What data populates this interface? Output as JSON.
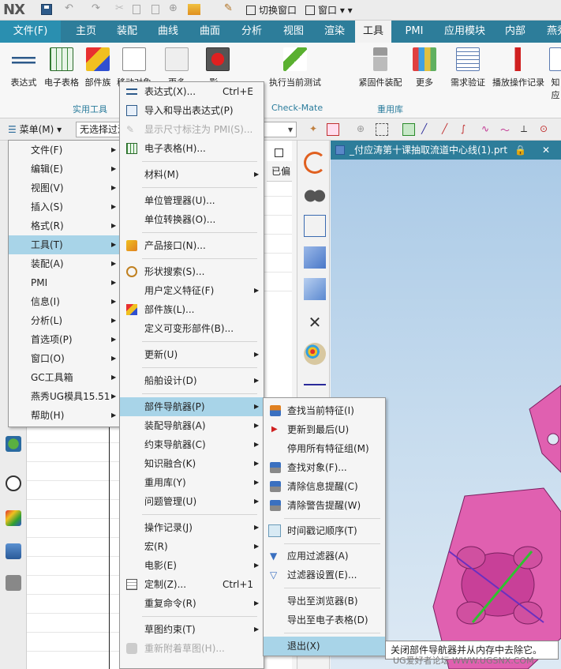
{
  "app": {
    "logo": "NX"
  },
  "titlebar": {
    "switch_window": "切换窗口",
    "window": "窗口"
  },
  "tabs": [
    "文件(F)",
    "主页",
    "装配",
    "曲线",
    "曲面",
    "分析",
    "视图",
    "渲染",
    "工具",
    "PMI",
    "应用模块",
    "内部",
    "燕秀"
  ],
  "ribbon": {
    "buttons": [
      "表达式",
      "电子表格",
      "部件族",
      "移动对象",
      "更多",
      "影...",
      "执行当前测试",
      "紧固件装配",
      "更多",
      "需求验证",
      "播放操作记录",
      "知应"
    ],
    "groups": [
      "实用工具",
      "Check-Mate",
      "重用库"
    ]
  },
  "cmdbar": {
    "menu": "菜单(M)",
    "filter": "无选择过滤器"
  },
  "nav": {
    "column_header": "已偏"
  },
  "graphics": {
    "tab_title": "_付应涛第十课抽取流道中心线(1).prt"
  },
  "menu_main": [
    {
      "label": "文件(F)",
      "sub": true
    },
    {
      "label": "编辑(E)",
      "sub": true
    },
    {
      "label": "视图(V)",
      "sub": true
    },
    {
      "label": "插入(S)",
      "sub": true
    },
    {
      "label": "格式(R)",
      "sub": true
    },
    {
      "label": "工具(T)",
      "sub": true
    },
    {
      "label": "装配(A)",
      "sub": true
    },
    {
      "label": "PMI",
      "sub": true
    },
    {
      "label": "信息(I)",
      "sub": true
    },
    {
      "label": "分析(L)",
      "sub": true
    },
    {
      "label": "首选项(P)",
      "sub": true
    },
    {
      "label": "窗口(O)",
      "sub": true
    },
    {
      "label": "GC工具箱",
      "sub": true
    },
    {
      "label": "燕秀UG模具15.51",
      "sub": true
    },
    {
      "label": "帮助(H)",
      "sub": true
    }
  ],
  "menu_tools": [
    {
      "label": "表达式(X)...",
      "shortcut": "Ctrl+E"
    },
    {
      "label": "导入和导出表达式(P)"
    },
    {
      "label": "显示尺寸标注为 PMI(S)..."
    },
    {
      "label": "电子表格(H)..."
    },
    {
      "label": "材料(M)"
    },
    {
      "label": "单位管理器(U)..."
    },
    {
      "label": "单位转换器(O)..."
    },
    {
      "label": "产品接口(N)..."
    },
    {
      "label": "形状搜索(S)..."
    },
    {
      "label": "用户定义特征(F)"
    },
    {
      "label": "部件族(L)..."
    },
    {
      "label": "定义可变形部件(B)..."
    },
    {
      "label": "更新(U)"
    },
    {
      "label": "船舶设计(D)"
    },
    {
      "label": "部件导航器(P)"
    },
    {
      "label": "装配导航器(A)"
    },
    {
      "label": "约束导航器(C)"
    },
    {
      "label": "知识融合(K)"
    },
    {
      "label": "重用库(Y)"
    },
    {
      "label": "问题管理(U)"
    },
    {
      "label": "操作记录(J)"
    },
    {
      "label": "宏(R)"
    },
    {
      "label": "电影(E)"
    },
    {
      "label": "定制(Z)...",
      "shortcut": "Ctrl+1"
    },
    {
      "label": "重复命令(R)"
    },
    {
      "label": "草图约束(T)"
    },
    {
      "label": "重新附着草图(H)..."
    }
  ],
  "menu_part_nav": [
    {
      "label": "查找当前特征(I)"
    },
    {
      "label": "更新到最后(U)"
    },
    {
      "label": "停用所有特征组(M)"
    },
    {
      "label": "查找对象(F)..."
    },
    {
      "label": "清除信息提醒(C)"
    },
    {
      "label": "清除警告提醒(W)"
    },
    {
      "label": "时间戳记顺序(T)"
    },
    {
      "label": "应用过滤器(A)"
    },
    {
      "label": "过滤器设置(E)..."
    },
    {
      "label": "导出至浏览器(B)"
    },
    {
      "label": "导出至电子表格(D)"
    },
    {
      "label": "退出(X)"
    }
  ],
  "tooltip": "关闭部件导航器并从内存中去除它。",
  "watermark": "UG爱好者论坛  WWW.UGSNX.COM",
  "colors": {
    "ribbon_tab_bg": "#2d7d9a",
    "highlight": "#a8d4e8",
    "part_pink": "#e060b0"
  }
}
